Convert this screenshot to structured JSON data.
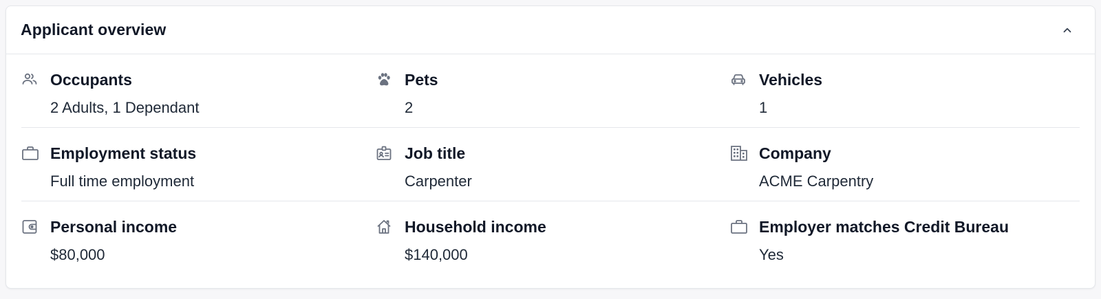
{
  "card": {
    "title": "Applicant overview",
    "collapse_icon": "chevron-up-icon"
  },
  "rows": [
    [
      {
        "icon": "users-icon",
        "label": "Occupants",
        "value": "2 Adults, 1 Dependant"
      },
      {
        "icon": "paw-icon",
        "label": "Pets",
        "value": "2"
      },
      {
        "icon": "car-icon",
        "label": "Vehicles",
        "value": "1"
      }
    ],
    [
      {
        "icon": "briefcase-icon",
        "label": "Employment status",
        "value": "Full time employment"
      },
      {
        "icon": "id-badge-icon",
        "label": "Job title",
        "value": "Carpenter"
      },
      {
        "icon": "building-icon",
        "label": "Company",
        "value": "ACME Carpentry"
      }
    ],
    [
      {
        "icon": "wallet-icon",
        "label": "Personal income",
        "value": "$80,000"
      },
      {
        "icon": "house-icon",
        "label": "Household income",
        "value": "$140,000"
      },
      {
        "icon": "briefcase-icon",
        "label": "Employer matches Credit Bureau",
        "value": "Yes"
      }
    ]
  ],
  "colors": {
    "icon": "#6b7280",
    "text": "#111827",
    "border": "#e5e7eb"
  }
}
